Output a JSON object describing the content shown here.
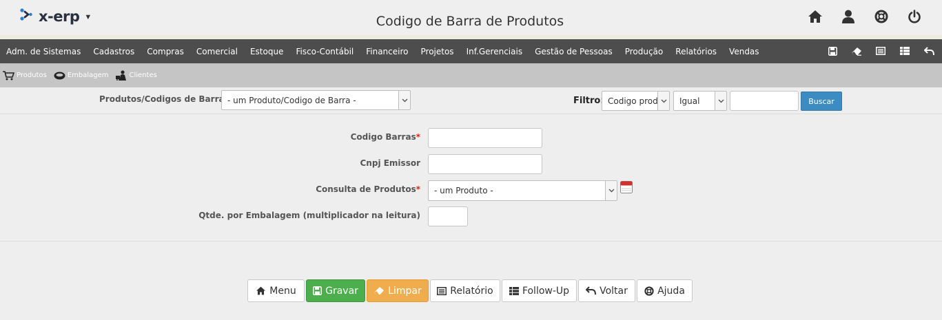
{
  "app": {
    "logo_text": "x-erp",
    "page_title": "Codigo de Barra de Produtos"
  },
  "top_icons": [
    "home-icon",
    "user-icon",
    "lifebuoy-icon",
    "power-icon"
  ],
  "menu": {
    "items": [
      "Adm. de Sistemas",
      "Cadastros",
      "Compras",
      "Comercial",
      "Estoque",
      "Fisco-Contábil",
      "Financeiro",
      "Projetos",
      "Inf.Gerenciais",
      "Gestão de Pessoas",
      "Produção",
      "Relatórios",
      "Vendas"
    ],
    "tools": [
      "save-icon",
      "eraser-icon",
      "list-icon",
      "table-icon",
      "undo-icon"
    ]
  },
  "submenu": {
    "items": [
      "Produtos",
      "Embalagem",
      "Clientes"
    ]
  },
  "filter": {
    "selector_label": "Produtos/Codigos de Barras",
    "selector_value": "- um Produto/Codigo de Barra -",
    "filtro_label": "Filtro:",
    "field_value": "Codigo produto",
    "operator_value": "Igual",
    "search_value": "",
    "buscar_label": "Buscar"
  },
  "form": {
    "codigo_barras_label": "Codigo Barras",
    "codigo_barras_value": "",
    "cnpj_label": "Cnpj Emissor",
    "cnpj_value": "",
    "consulta_label": "Consulta de Produtos",
    "consulta_value": "- um Produto -",
    "qtde_label": "Qtde. por Embalagem (multiplicador na leitura)",
    "qtde_value": "",
    "required_mark": "*"
  },
  "buttons": {
    "menu": "Menu",
    "gravar": "Gravar",
    "limpar": "Limpar",
    "relatorio": "Relatório",
    "followup": "Follow-Up",
    "voltar": "Voltar",
    "ajuda": "Ajuda"
  },
  "colors": {
    "menubar": "#4d4d4d",
    "submenu": "#c5c5c5",
    "gravar": "#4cae4c",
    "limpar": "#f0ad4e",
    "buscar": "#3d8cc1",
    "required": "#d9230f"
  }
}
